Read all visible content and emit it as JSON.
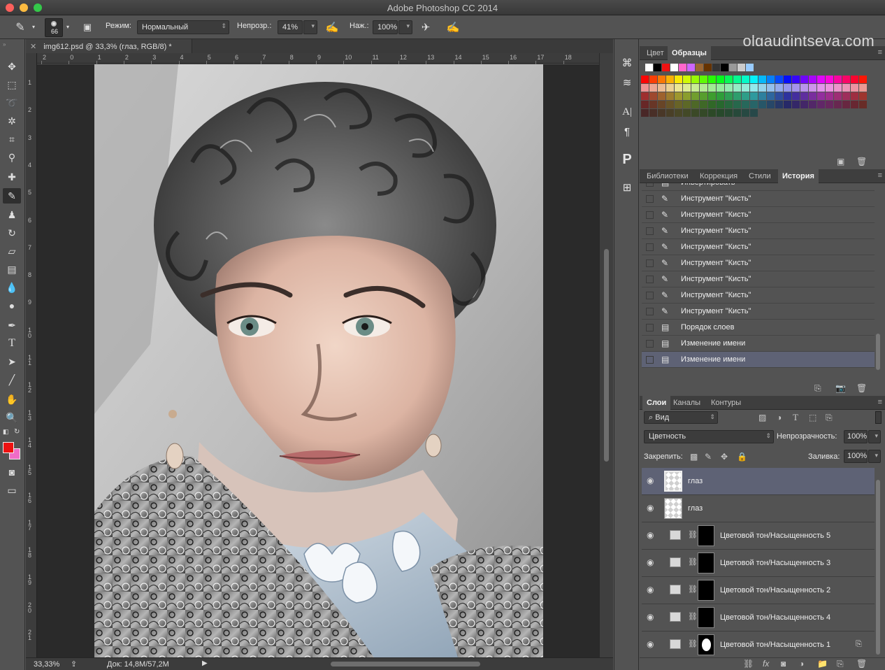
{
  "window": {
    "title": "Adobe Photoshop CC 2014"
  },
  "watermark": "olgaudintseva.com",
  "options": {
    "brush_size": "66",
    "mode_label": "Режим:",
    "mode_value": "Нормальный",
    "opacity_label": "Непрозр.:",
    "opacity_value": "41%",
    "flow_label": "Наж.:",
    "flow_value": "100%"
  },
  "document": {
    "tab_title": "img612.psd @ 33,3% (глаз, RGB/8) *",
    "ruler_top": [
      "2",
      "0",
      "1",
      "2",
      "3",
      "4",
      "5",
      "6",
      "7",
      "8",
      "9",
      "10",
      "11",
      "12",
      "13",
      "14",
      "15",
      "16",
      "17",
      "18"
    ],
    "ruler_left": [
      "1",
      "2",
      "3",
      "4",
      "5",
      "6",
      "7",
      "8",
      "9",
      "10",
      "11",
      "12",
      "13",
      "14",
      "15",
      "16",
      "17",
      "18",
      "19",
      "20",
      "21"
    ]
  },
  "status": {
    "zoom": "33,33%",
    "doc_info": "Док: 14,8M/57,2M"
  },
  "swatches_panel": {
    "tabs": [
      "Цвет",
      "Образцы"
    ],
    "active_tab": "Образцы"
  },
  "history_panel": {
    "tabs": [
      "Библиотеки",
      "Коррекция",
      "Стили",
      "История"
    ],
    "active_tab": "История",
    "items": [
      {
        "label": "Инвертировать",
        "icon": "document-icon"
      },
      {
        "label": "Инструмент \"Кисть\"",
        "icon": "brush-icon"
      },
      {
        "label": "Инструмент \"Кисть\"",
        "icon": "brush-icon"
      },
      {
        "label": "Инструмент \"Кисть\"",
        "icon": "brush-icon"
      },
      {
        "label": "Инструмент \"Кисть\"",
        "icon": "brush-icon"
      },
      {
        "label": "Инструмент \"Кисть\"",
        "icon": "brush-icon"
      },
      {
        "label": "Инструмент \"Кисть\"",
        "icon": "brush-icon"
      },
      {
        "label": "Инструмент \"Кисть\"",
        "icon": "brush-icon"
      },
      {
        "label": "Инструмент \"Кисть\"",
        "icon": "brush-icon"
      },
      {
        "label": "Порядок слоев",
        "icon": "document-icon"
      },
      {
        "label": "Изменение имени",
        "icon": "document-icon"
      },
      {
        "label": "Изменение имени",
        "icon": "document-icon",
        "selected": true
      }
    ]
  },
  "layers_panel": {
    "tabs": [
      "Слои",
      "Каналы",
      "Контуры"
    ],
    "active_tab": "Слои",
    "filter_label": "Вид",
    "blend_mode": "Цветность",
    "opacity_label": "Непрозрачность:",
    "opacity_value": "100%",
    "lock_label": "Закрепить:",
    "fill_label": "Заливка:",
    "fill_value": "100%",
    "layers": [
      {
        "name": "глаз",
        "type": "pixel",
        "selected": true
      },
      {
        "name": "глаз",
        "type": "pixel"
      },
      {
        "name": "Цветовой тон/Насыщенность 5",
        "type": "adjustment"
      },
      {
        "name": "Цветовой тон/Насыщенность 3",
        "type": "adjustment"
      },
      {
        "name": "Цветовой тон/Насыщенность 2",
        "type": "adjustment"
      },
      {
        "name": "Цветовой тон/Насыщенность 4",
        "type": "adjustment"
      },
      {
        "name": "Цветовой тон/Насыщенность 1",
        "type": "adjustment"
      }
    ]
  },
  "colors": {
    "foreground": "#e11111",
    "background": "#f06cc6",
    "selection": "#5e6275"
  }
}
